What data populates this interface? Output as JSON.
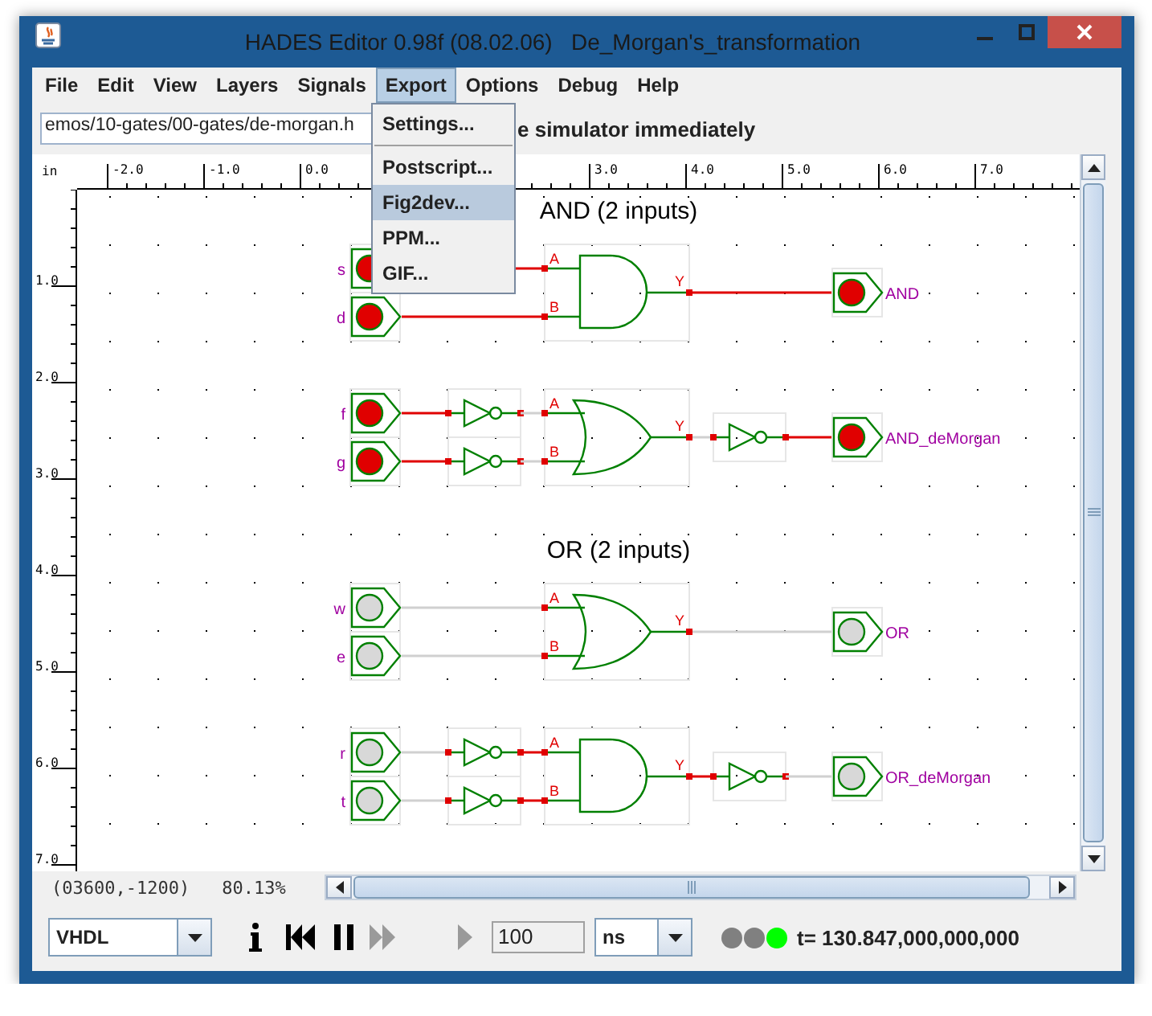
{
  "window": {
    "title": "HADES Editor 0.98f (08.02.06)   De_Morgan's_transformation"
  },
  "menu": [
    {
      "label": "File",
      "selected": false
    },
    {
      "label": "Edit",
      "selected": false
    },
    {
      "label": "View",
      "selected": false
    },
    {
      "label": "Layers",
      "selected": false
    },
    {
      "label": "Signals",
      "selected": false
    },
    {
      "label": "Export",
      "selected": true
    },
    {
      "label": "Options",
      "selected": false
    },
    {
      "label": "Debug",
      "selected": false
    },
    {
      "label": "Help",
      "selected": false
    }
  ],
  "export_menu": [
    {
      "label": "Settings...",
      "selected": false,
      "separator_after": true
    },
    {
      "label": "Postscript...",
      "selected": false,
      "separator_after": false
    },
    {
      "label": "Fig2dev...",
      "selected": true,
      "separator_after": false
    },
    {
      "label": "PPM...",
      "selected": false,
      "separator_after": false
    },
    {
      "label": "GIF...",
      "selected": false,
      "separator_after": false
    }
  ],
  "toolbar": {
    "path_field": {
      "value": "emos/10-gates/00-gates/de-morgan.h"
    },
    "message": "e simulator immediately"
  },
  "ruler": {
    "unit": "in",
    "top_left_labels": [
      "-2.0",
      "-1.0",
      "0.0"
    ],
    "top_right_labels": [
      "3.0",
      "4.0",
      "5.0",
      "6.0",
      "7.0"
    ],
    "left_labels": [
      "1.0",
      "2.0",
      "3.0",
      "4.0",
      "5.0",
      "6.0",
      "7.0"
    ]
  },
  "sections": [
    {
      "title": "AND (2 inputs)",
      "circuits": [
        {
          "kind": "and",
          "inverted_inputs": false,
          "inverted_output": false,
          "pins": [
            "A",
            "B",
            "Y"
          ],
          "inputs": [
            {
              "name": "s",
              "on": true
            },
            {
              "name": "d",
              "on": true
            }
          ],
          "output": {
            "name": "AND",
            "on": true
          }
        },
        {
          "kind": "or",
          "inverted_inputs": true,
          "inverted_output": true,
          "pins": [
            "A",
            "B",
            "Y"
          ],
          "inputs": [
            {
              "name": "f",
              "on": true
            },
            {
              "name": "g",
              "on": true
            }
          ],
          "output": {
            "name": "AND_deMorgan",
            "on": true
          }
        }
      ]
    },
    {
      "title": "OR (2 inputs)",
      "circuits": [
        {
          "kind": "or",
          "inverted_inputs": false,
          "inverted_output": false,
          "pins": [
            "A",
            "B",
            "Y"
          ],
          "inputs": [
            {
              "name": "w",
              "on": false
            },
            {
              "name": "e",
              "on": false
            }
          ],
          "output": {
            "name": "OR",
            "on": false
          }
        },
        {
          "kind": "and",
          "inverted_inputs": true,
          "inverted_output": true,
          "pins": [
            "A",
            "B",
            "Y"
          ],
          "inputs": [
            {
              "name": "r",
              "on": false
            },
            {
              "name": "t",
              "on": false
            }
          ],
          "output": {
            "name": "OR_deMorgan",
            "on": false
          }
        }
      ]
    }
  ],
  "status": {
    "coordinates": "(03600,-1200)",
    "zoom": "80.13%"
  },
  "simulation": {
    "language": "VHDL",
    "tools": [
      {
        "kind": "info",
        "disabled": false
      },
      {
        "kind": "rewind",
        "disabled": false
      },
      {
        "kind": "pause",
        "disabled": false
      },
      {
        "kind": "fast_forward",
        "disabled": true
      },
      {
        "kind": "play",
        "disabled": true
      }
    ],
    "step": "100",
    "unit": "ns",
    "indicators": [
      {
        "color": "#808080"
      },
      {
        "color": "#808080"
      },
      {
        "color": "#00ff00"
      }
    ],
    "time": "t= 130.847,000,000,000"
  }
}
